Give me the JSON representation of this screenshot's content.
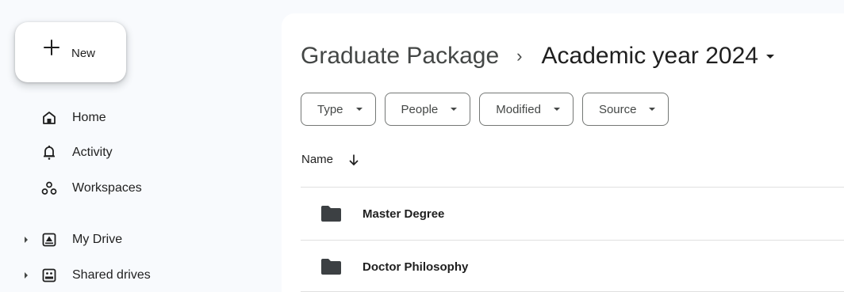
{
  "sidebar": {
    "new_label": "New",
    "items": [
      {
        "label": "Home",
        "icon": "home-icon"
      },
      {
        "label": "Activity",
        "icon": "bell-icon"
      },
      {
        "label": "Workspaces",
        "icon": "workspaces-icon"
      },
      {
        "label": "My Drive",
        "icon": "my-drive-icon"
      },
      {
        "label": "Shared drives",
        "icon": "shared-drives-icon"
      }
    ]
  },
  "breadcrumb": {
    "parent": "Graduate Package",
    "separator": "›",
    "current": "Academic year 2024"
  },
  "filters": [
    {
      "label": "Type"
    },
    {
      "label": "People"
    },
    {
      "label": "Modified"
    },
    {
      "label": "Source"
    }
  ],
  "list": {
    "name_header": "Name",
    "sort_icon": "arrow-down-icon",
    "rows": [
      {
        "label": "Master Degree",
        "icon": "folder-icon"
      },
      {
        "label": "Doctor Philosophy",
        "icon": "folder-icon"
      }
    ]
  },
  "colors": {
    "background": "#f8fafd",
    "surface": "#ffffff",
    "text": "#1f1f1f",
    "muted": "#444746"
  }
}
